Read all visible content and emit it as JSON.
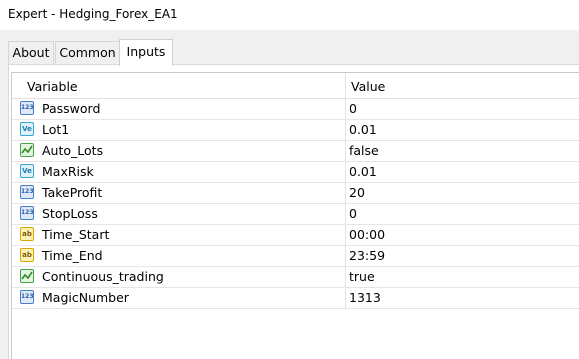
{
  "window": {
    "title": "Expert - Hedging_Forex_EA1"
  },
  "tabs": [
    {
      "label": "About"
    },
    {
      "label": "Common"
    },
    {
      "label": "Inputs"
    }
  ],
  "table": {
    "columns": [
      "Variable",
      "Value"
    ],
    "rows": [
      {
        "name": "Password",
        "value": "0",
        "type_icon": "integer-type-icon"
      },
      {
        "name": "Lot1",
        "value": "0.01",
        "type_icon": "double-type-icon"
      },
      {
        "name": "Auto_Lots",
        "value": "false",
        "type_icon": "boolean-type-icon"
      },
      {
        "name": "MaxRisk",
        "value": "0.01",
        "type_icon": "double-type-icon"
      },
      {
        "name": "TakeProfit",
        "value": "20",
        "type_icon": "integer-type-icon"
      },
      {
        "name": "StopLoss",
        "value": "0",
        "type_icon": "integer-type-icon"
      },
      {
        "name": "Time_Start",
        "value": "00:00",
        "type_icon": "string-type-icon"
      },
      {
        "name": "Time_End",
        "value": "23:59",
        "type_icon": "string-type-icon"
      },
      {
        "name": "Continuous_trading",
        "value": "true",
        "type_icon": "boolean-type-icon"
      },
      {
        "name": "MagicNumber",
        "value": "1313",
        "type_icon": "integer-type-icon"
      }
    ]
  }
}
